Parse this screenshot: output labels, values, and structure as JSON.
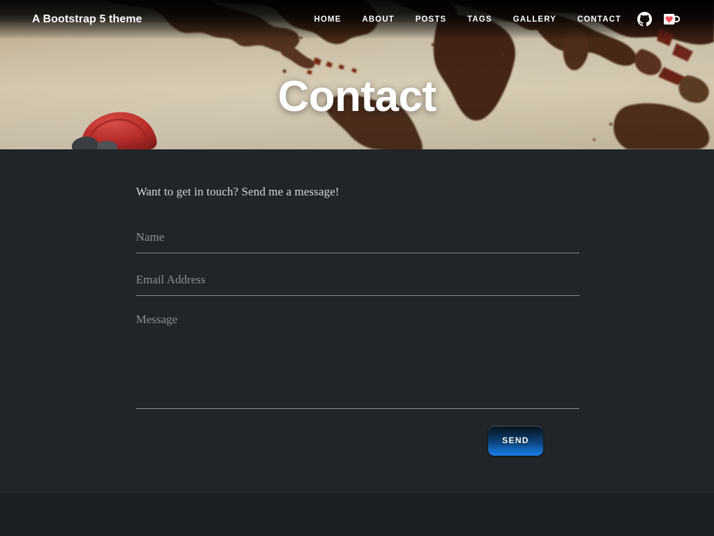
{
  "navbar": {
    "brand": "A Bootstrap 5 theme",
    "links": [
      {
        "label": "HOME",
        "name": "nav-link-home"
      },
      {
        "label": "ABOUT",
        "name": "nav-link-about"
      },
      {
        "label": "POSTS",
        "name": "nav-link-posts"
      },
      {
        "label": "TAGS",
        "name": "nav-link-tags"
      },
      {
        "label": "GALLERY",
        "name": "nav-link-gallery"
      },
      {
        "label": "CONTACT",
        "name": "nav-link-contact"
      }
    ],
    "icons": [
      {
        "name": "github-icon",
        "label": "GitHub"
      },
      {
        "name": "coffee-cup-heart-icon",
        "label": "Buy me a coffee"
      }
    ],
    "overlay_color": "#000000",
    "text_color": "#ffffff"
  },
  "hero": {
    "title": "Contact",
    "title_color": "#ffffff",
    "background_description": "coffee spilled in the shape of a world map on beige paper with a red cup lid",
    "background_colors": {
      "paper": "#cdbfa4",
      "coffee_dark": "#4a2a18",
      "coffee_mid": "#6b3c21",
      "red_object": "#c4302b"
    }
  },
  "main": {
    "lead": "Want to get in touch? Send me a message!",
    "background_color": "#212529",
    "fields": [
      {
        "name": "name-input",
        "placeholder": "Name",
        "value": "",
        "type": "text"
      },
      {
        "name": "email-input",
        "placeholder": "Email Address",
        "value": "",
        "type": "email"
      },
      {
        "name": "message-input",
        "placeholder": "Message",
        "value": "",
        "type": "textarea"
      }
    ],
    "send_button": {
      "label": "Send",
      "gradient_top": "#07121c",
      "gradient_bottom": "#1a7ae0",
      "text_color": "#ffffff"
    }
  },
  "footer": {
    "background_color": "#1c1f23"
  }
}
